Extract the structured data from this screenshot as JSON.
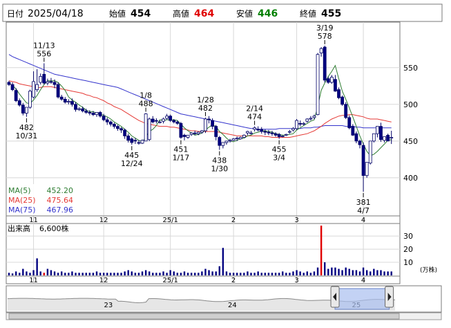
{
  "header": {
    "date_label": "日付",
    "date_value": "2025/04/18",
    "open_label": "始値",
    "open_value": "454",
    "high_label": "高値",
    "high_value": "464",
    "low_label": "安値",
    "low_value": "446",
    "close_label": "終値",
    "close_value": "455",
    "colors": {
      "high": "#e00000",
      "low": "#008000",
      "text": "#000000"
    }
  },
  "chart_data": {
    "type": "candlestick",
    "price_axis": {
      "ylim": [
        348,
        612
      ],
      "ticks": [
        400,
        450,
        500,
        550
      ]
    },
    "x_month_labels": [
      {
        "label": "11",
        "index": 7
      },
      {
        "label": "12",
        "index": 27
      },
      {
        "label": "25/1",
        "index": 46
      },
      {
        "label": "2",
        "index": 64
      },
      {
        "label": "3",
        "index": 82
      },
      {
        "label": "4",
        "index": 101
      }
    ],
    "moving_averages": [
      {
        "name": "MA(5)",
        "value": "452.20",
        "color": "#2e7d32"
      },
      {
        "name": "MA(25)",
        "value": "475.64",
        "color": "#e53935"
      },
      {
        "name": "MA(75)",
        "value": "467.96",
        "color": "#3333cc"
      }
    ],
    "candles": {
      "open": [
        530,
        527,
        519,
        505,
        499,
        488,
        496,
        510,
        520,
        530,
        541,
        529,
        531,
        530,
        527,
        510,
        507,
        503,
        504,
        500,
        493,
        494,
        491,
        489,
        488,
        486,
        489,
        484,
        479,
        476,
        473,
        470,
        467,
        465,
        457,
        453,
        451,
        448,
        447,
        450,
        452,
        480,
        478,
        476,
        477,
        481,
        484,
        478,
        476,
        474,
        458,
        455,
        459,
        461,
        460,
        462,
        464,
        480,
        478,
        470,
        455,
        444,
        448,
        450,
        451,
        453,
        453,
        455,
        461,
        461,
        466,
        466,
        466,
        463,
        462,
        461,
        460,
        459,
        456,
        458,
        462,
        465,
        467,
        474,
        473,
        477,
        480,
        482,
        486,
        570,
        578,
        535,
        530,
        534,
        520,
        510,
        500,
        482,
        470,
        460,
        450,
        444,
        403,
        420,
        450,
        460,
        470,
        451,
        458,
        454
      ],
      "high": [
        532,
        530,
        522,
        508,
        502,
        492,
        520,
        545,
        548,
        542,
        556,
        535,
        536,
        534,
        530,
        513,
        510,
        507,
        508,
        503,
        496,
        497,
        494,
        492,
        491,
        489,
        491,
        487,
        482,
        478,
        475,
        472,
        469,
        467,
        460,
        455,
        454,
        451,
        452,
        488,
        482,
        484,
        481,
        478,
        482,
        487,
        486,
        480,
        478,
        476,
        460,
        458,
        462,
        464,
        463,
        465,
        482,
        484,
        481,
        472,
        457,
        447,
        450,
        453,
        454,
        456,
        456,
        459,
        464,
        464,
        470,
        470,
        469,
        466,
        465,
        464,
        462,
        461,
        458,
        460,
        465,
        469,
        480,
        478,
        476,
        481,
        484,
        486,
        570,
        578,
        580,
        538,
        540,
        540,
        523,
        512,
        503,
        485,
        473,
        463,
        452,
        448,
        410,
        428,
        453,
        462,
        475,
        455,
        460,
        464
      ],
      "low": [
        525,
        518,
        503,
        497,
        485,
        483,
        494,
        508,
        517,
        527,
        527,
        526,
        528,
        522,
        508,
        505,
        501,
        500,
        497,
        490,
        491,
        489,
        487,
        485,
        484,
        483,
        482,
        477,
        472,
        470,
        467,
        464,
        461,
        453,
        448,
        445,
        446,
        445,
        446,
        450,
        450,
        474,
        474,
        474,
        474,
        479,
        476,
        474,
        472,
        453,
        451,
        453,
        457,
        458,
        458,
        460,
        461,
        474,
        466,
        451,
        438,
        440,
        445,
        448,
        450,
        450,
        452,
        455,
        458,
        459,
        463,
        463,
        460,
        458,
        458,
        457,
        456,
        453,
        455,
        457,
        460,
        463,
        465,
        470,
        471,
        475,
        478,
        480,
        485,
        565,
        530,
        528,
        528,
        517,
        507,
        498,
        480,
        466,
        457,
        447,
        440,
        381,
        400,
        418,
        448,
        455,
        449,
        448,
        452,
        446
      ],
      "close": [
        527,
        520,
        505,
        499,
        488,
        496,
        518,
        531,
        527,
        538,
        529,
        531,
        530,
        527,
        510,
        507,
        503,
        504,
        500,
        493,
        494,
        491,
        489,
        488,
        486,
        489,
        484,
        479,
        476,
        473,
        470,
        467,
        465,
        457,
        451,
        448,
        450,
        447,
        451,
        487,
        480,
        476,
        477,
        476,
        480,
        484,
        478,
        476,
        474,
        455,
        456,
        458,
        461,
        460,
        462,
        464,
        480,
        479,
        470,
        456,
        444,
        448,
        450,
        451,
        453,
        454,
        455,
        458,
        463,
        461,
        468,
        465,
        463,
        462,
        461,
        460,
        458,
        456,
        457,
        459,
        463,
        467,
        478,
        473,
        474,
        480,
        481,
        484,
        568,
        576,
        533,
        530,
        537,
        518,
        509,
        500,
        482,
        468,
        458,
        450,
        445,
        403,
        421,
        450,
        460,
        470,
        452,
        456,
        450,
        455
      ]
    },
    "ma": {
      "ma5": [
        528,
        526,
        521,
        514,
        508,
        502,
        501,
        506,
        512,
        520,
        527,
        532,
        532,
        532,
        530,
        525,
        519,
        510,
        506,
        503,
        499,
        496,
        492,
        490,
        490,
        488,
        487,
        485,
        483,
        480,
        476,
        473,
        470,
        466,
        462,
        457,
        454,
        451,
        449,
        455,
        463,
        466,
        471,
        479,
        478,
        479,
        479,
        479,
        478,
        473,
        468,
        464,
        461,
        458,
        459,
        461,
        465,
        469,
        472,
        470,
        463,
        459,
        454,
        450,
        449,
        451,
        453,
        454,
        457,
        458,
        461,
        462,
        464,
        464,
        463,
        462,
        460,
        459,
        458,
        458,
        459,
        460,
        465,
        468,
        471,
        474,
        477,
        479,
        497,
        519,
        529,
        538,
        545,
        553,
        535,
        518,
        507,
        495,
        483,
        470,
        457,
        446,
        436,
        430,
        432,
        436,
        441,
        446,
        451,
        452
      ],
      "ma25": [
        532,
        531,
        530,
        528,
        527,
        526,
        525,
        524,
        523,
        523,
        524,
        524,
        524,
        523,
        522,
        521,
        520,
        519,
        518,
        517,
        516,
        515,
        513,
        512,
        510,
        509,
        507,
        505,
        502,
        500,
        497,
        495,
        493,
        490,
        487,
        484,
        481,
        478,
        476,
        474,
        473,
        472,
        471,
        470,
        470,
        470,
        469,
        469,
        468,
        467,
        466,
        465,
        464,
        464,
        463,
        463,
        463,
        463,
        463,
        463,
        462,
        461,
        460,
        459,
        458,
        457,
        457,
        457,
        457,
        457,
        457,
        457,
        457,
        456,
        456,
        455,
        455,
        455,
        455,
        455,
        455,
        456,
        457,
        458,
        459,
        460,
        462,
        464,
        467,
        470,
        474,
        477,
        480,
        482,
        484,
        485,
        485,
        486,
        486,
        485,
        484,
        483,
        481,
        480,
        480,
        480,
        479,
        478,
        477,
        476
      ],
      "ma75": [
        568,
        565,
        563,
        561,
        559,
        557,
        555,
        553,
        551,
        549,
        547,
        545,
        543,
        541,
        540,
        539,
        538,
        537,
        536,
        535,
        534,
        533,
        532,
        531,
        530,
        529,
        528,
        527,
        526,
        525,
        524,
        523,
        521,
        519,
        517,
        515,
        513,
        511,
        509,
        507,
        505,
        503,
        501,
        499,
        497,
        495,
        493,
        491,
        489,
        487,
        486,
        485,
        484,
        483,
        482,
        481,
        480,
        479,
        478,
        477,
        476,
        475,
        474,
        473,
        472,
        471,
        470,
        469,
        468,
        467,
        467,
        466,
        466,
        466,
        466,
        466,
        466,
        467,
        467,
        467,
        467,
        467,
        467,
        467,
        468,
        468,
        468,
        469,
        469,
        470,
        471,
        471,
        471,
        471,
        471,
        471,
        470,
        470,
        470,
        469,
        469,
        468,
        468,
        468,
        468,
        468,
        468,
        468,
        468,
        468
      ]
    },
    "annotations": [
      {
        "index": 10,
        "type": "high",
        "date": "11/13",
        "price": "556"
      },
      {
        "index": 5,
        "type": "low",
        "price": "482",
        "date": "10/31"
      },
      {
        "index": 35,
        "type": "low",
        "price": "445",
        "date": "12/24"
      },
      {
        "index": 39,
        "type": "high",
        "date": "1/8",
        "price": "488"
      },
      {
        "index": 49,
        "type": "low",
        "price": "451",
        "date": "1/17"
      },
      {
        "index": 56,
        "type": "high",
        "date": "1/28",
        "price": "482"
      },
      {
        "index": 60,
        "type": "low",
        "price": "438",
        "date": "1/30"
      },
      {
        "index": 70,
        "type": "high",
        "date": "2/14",
        "price": "474"
      },
      {
        "index": 77,
        "type": "low",
        "price": "455",
        "date": "3/4"
      },
      {
        "index": 90,
        "type": "high",
        "date": "3/19",
        "price": "578"
      },
      {
        "index": 101,
        "type": "low",
        "price": "381",
        "date": "4/7"
      }
    ],
    "volume": {
      "label": "出来高",
      "value": "6,600株",
      "unit": "(万株)",
      "ylim": [
        0,
        38
      ],
      "ticks": [
        10,
        20,
        30
      ],
      "values": [
        2,
        1.5,
        3,
        2,
        5,
        3,
        2,
        4,
        13,
        3,
        2,
        5,
        4,
        3,
        2,
        3,
        2,
        2,
        3,
        2,
        2,
        2,
        2,
        2,
        2,
        3,
        2,
        2,
        2,
        2,
        2,
        2,
        2,
        3,
        4,
        3,
        2,
        2,
        3,
        4,
        3,
        2,
        2,
        2,
        3,
        2,
        4,
        3,
        2,
        2,
        3,
        2,
        2,
        2,
        2,
        3,
        5,
        4,
        3,
        3,
        7,
        21,
        3,
        2,
        2,
        2,
        2,
        2,
        3,
        2,
        2,
        3,
        2,
        2,
        2,
        2,
        2,
        2,
        3,
        2,
        2,
        3,
        4,
        3,
        2,
        3,
        2,
        3,
        6,
        38,
        10,
        5,
        6,
        6,
        5,
        4,
        6,
        5,
        4,
        4,
        3,
        6,
        4,
        3,
        5,
        4,
        4,
        3,
        3,
        3
      ],
      "highlight_red_indices": [
        10,
        89
      ]
    },
    "navigator": {
      "year_labels": [
        {
          "label": "23",
          "pos": 0.26
        },
        {
          "label": "24",
          "pos": 0.58
        },
        {
          "label": "25",
          "pos": 0.9
        }
      ],
      "window": [
        0.845,
        0.985
      ]
    }
  }
}
